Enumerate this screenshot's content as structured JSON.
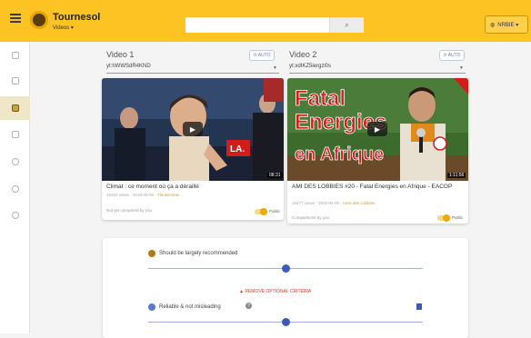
{
  "header": {
    "brand": "Tournesol",
    "subtitle": "Videos ▾",
    "search_placeholder": "",
    "search_icon": "⌕",
    "account_label": "NRBIE ▾",
    "account_icon": "user-icon"
  },
  "sidebar": {
    "items": [
      {
        "name": "home-icon"
      },
      {
        "name": "documents-icon"
      },
      {
        "name": "compare-icon",
        "active": true
      },
      {
        "name": "list-icon"
      },
      {
        "name": "settings-icon"
      },
      {
        "name": "info-icon"
      },
      {
        "name": "about-icon"
      }
    ]
  },
  "video1": {
    "heading": "Video 1",
    "auto_label": "⟳ AUTO",
    "id_value": "yt:hWWSdR4KND",
    "duration": "08:31",
    "overlay_text": "LA.",
    "title": "Climat : ce moment où ça a déraillé",
    "meta": "16482 views · 2019-09-06 · ",
    "meta_link": "Thinkerview",
    "footer": "Not yet compared by you",
    "toggle_label": "Public"
  },
  "video2": {
    "heading": "Video 2",
    "auto_label": "⟳ AUTO",
    "id_value": "yt:xdIKZ5iergzl0s",
    "duration": "1:11:56",
    "overlay_line1": "Fatal",
    "overlay_line2": "Energies",
    "overlay_line3": "en Afrique",
    "title": "AMI DES LOBBIES #20 - Fatal Energies en Afrique - EACOP",
    "meta": "15477 views · 2023-03-26 · ",
    "meta_link": "Amis des Lobbies",
    "footer": "Comparisons by you",
    "toggle_label": "Public"
  },
  "criteria": {
    "item1_label": "Should be largely recommended",
    "remove_label": "▲ REMOVE OPTIONAL CRITERIA",
    "item2_label": "Reliable & not misleading",
    "info_badge": "?"
  },
  "colors": {
    "brand_yellow": "#fdc323",
    "accent_blue": "#3d5ab7",
    "danger_red": "#d63a2a"
  }
}
